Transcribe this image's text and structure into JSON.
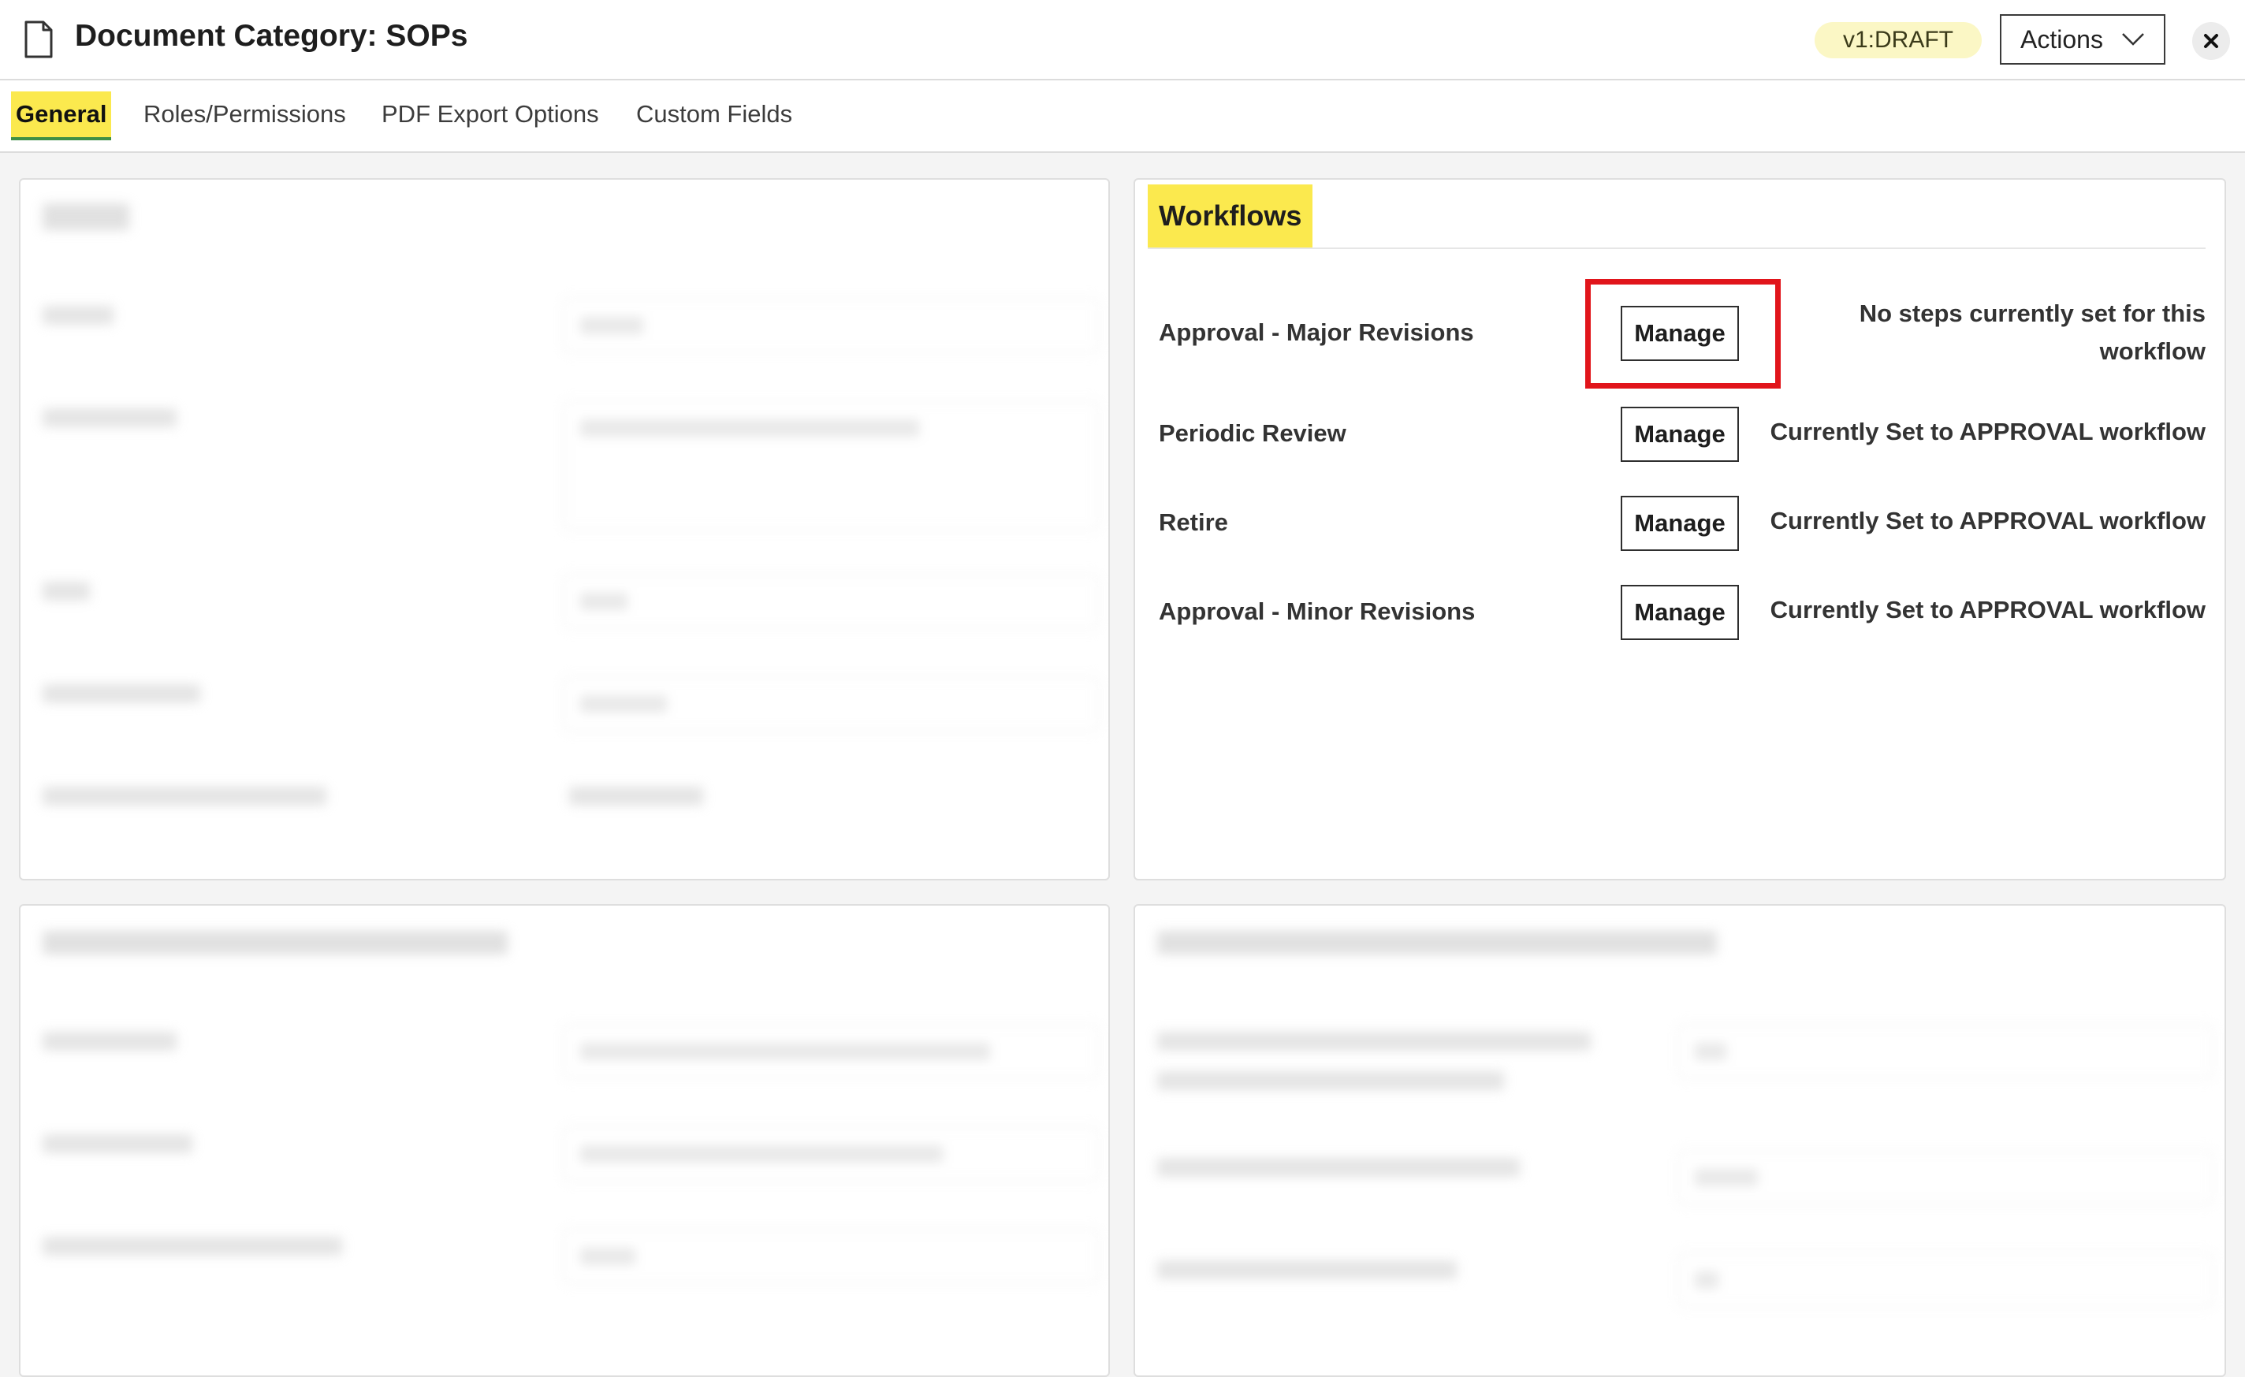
{
  "header": {
    "title": "Document Category: SOPs",
    "version_badge": "v1:DRAFT",
    "actions_label": "Actions",
    "icons": [
      "document-icon",
      "chevron-down-icon",
      "close-icon"
    ]
  },
  "tabs": [
    {
      "label": "General",
      "active": true
    },
    {
      "label": "Roles/Permissions",
      "active": false
    },
    {
      "label": "PDF Export Options",
      "active": false
    },
    {
      "label": "Custom Fields",
      "active": false
    }
  ],
  "workflows": {
    "heading": "Workflows",
    "rows": [
      {
        "name": "Approval - Major Revisions",
        "button": "Manage",
        "status": "No steps currently set for this workflow"
      },
      {
        "name": "Periodic Review",
        "button": "Manage",
        "status": "Currently Set to APPROVAL workflow"
      },
      {
        "name": "Retire",
        "button": "Manage",
        "status": "Currently Set to APPROVAL workflow"
      },
      {
        "name": "Approval - Minor Revisions",
        "button": "Manage",
        "status": "Currently Set to APPROVAL workflow"
      }
    ]
  },
  "colors": {
    "highlight": "#fbe94e",
    "annotation_box": "#e1151b",
    "badge_bg": "#fbf7c5",
    "active_tab_underline": "#3f8f45"
  }
}
